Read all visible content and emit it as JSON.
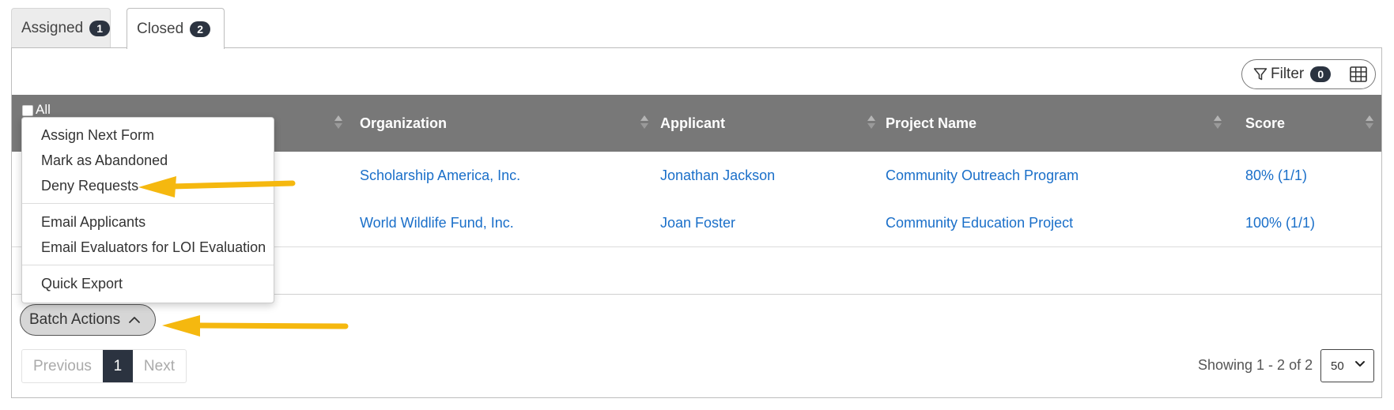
{
  "tabs": [
    {
      "label": "Assigned",
      "count": "1"
    },
    {
      "label": "Closed",
      "count": "2"
    }
  ],
  "toolbar": {
    "filter_label": "Filter",
    "filter_count": "0"
  },
  "table": {
    "select_all": "All",
    "columns": [
      "Organization",
      "Applicant",
      "Project Name",
      "Score"
    ],
    "rows": [
      {
        "organization": "Scholarship America, Inc.",
        "applicant": "Jonathan Jackson",
        "project": "Community Outreach Program",
        "score": "80% (1/1)"
      },
      {
        "organization": "World Wildlife Fund, Inc.",
        "applicant": "Joan Foster",
        "project": "Community Education Project",
        "score": "100% (1/1)"
      }
    ]
  },
  "batch_menu": {
    "button_label": "Batch Actions",
    "items": [
      "Assign Next Form",
      "Mark as Abandoned",
      "Deny Requests",
      "Email Applicants",
      "Email Evaluators for LOI Evaluation",
      "Quick Export"
    ]
  },
  "pagination": {
    "previous": "Previous",
    "current": "1",
    "next": "Next",
    "showing": "Showing 1 - 2 of 2",
    "per_page": "50"
  },
  "colors": {
    "accent_arrow": "#f5b80f",
    "link": "#1a6fc9",
    "header_bg": "#787878",
    "badge_bg": "#2b3340"
  }
}
